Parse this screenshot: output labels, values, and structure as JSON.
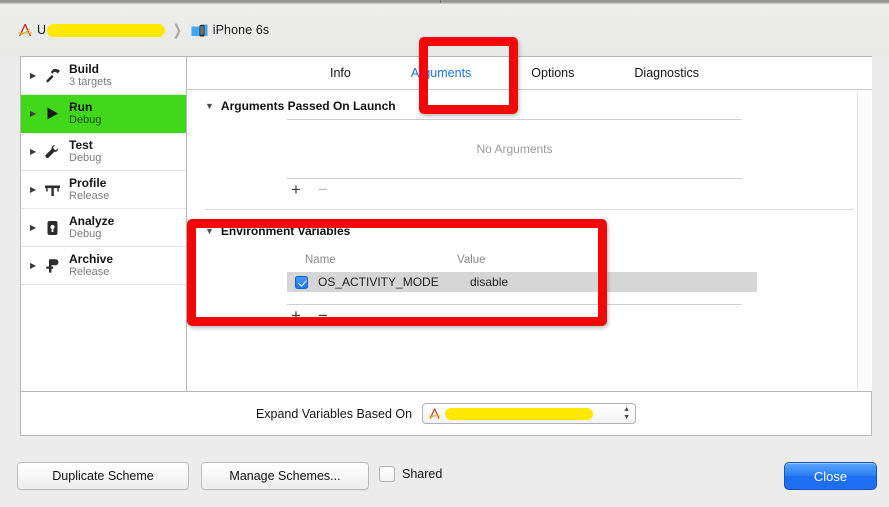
{
  "window": {
    "breadcrumb": {
      "scheme_icon": "xcode-scheme-icon",
      "scheme_prefix": "U",
      "scheme_redacted": true,
      "separator": "❯",
      "device_icon": "simulator-device-icon",
      "device_name": "iPhone 6s"
    }
  },
  "sidebar": {
    "items": [
      {
        "title": "Build",
        "subtitle": "3 targets",
        "icon": "hammer-icon",
        "selected": false
      },
      {
        "title": "Run",
        "subtitle": "Debug",
        "icon": "play-icon",
        "selected": true
      },
      {
        "title": "Test",
        "subtitle": "Debug",
        "icon": "wrench-icon",
        "selected": false
      },
      {
        "title": "Profile",
        "subtitle": "Release",
        "icon": "gauge-icon",
        "selected": false
      },
      {
        "title": "Analyze",
        "subtitle": "Debug",
        "icon": "analyze-icon",
        "selected": false
      },
      {
        "title": "Archive",
        "subtitle": "Release",
        "icon": "archive-icon",
        "selected": false
      }
    ]
  },
  "tabs": [
    {
      "label": "Info",
      "active": false
    },
    {
      "label": "Arguments",
      "active": true
    },
    {
      "label": "Options",
      "active": false
    },
    {
      "label": "Diagnostics",
      "active": false
    }
  ],
  "arguments_section": {
    "title": "Arguments Passed On Launch",
    "empty_text": "No Arguments",
    "add_label": "+",
    "remove_label": "−"
  },
  "environment_section": {
    "title": "Environment Variables",
    "columns": {
      "name": "Name",
      "value": "Value"
    },
    "rows": [
      {
        "enabled": true,
        "name": "OS_ACTIVITY_MODE",
        "value": "disable",
        "selected": true
      }
    ],
    "add_label": "+",
    "remove_label": "−"
  },
  "expand_variables": {
    "label": "Expand Variables Based On",
    "popup_icon": "xcode-scheme-icon",
    "popup_value_redacted": true,
    "stepper_up": "▲",
    "stepper_down": "▼"
  },
  "bottom_bar": {
    "duplicate_scheme": "Duplicate Scheme",
    "manage_schemes": "Manage Schemes...",
    "shared_label": "Shared",
    "shared_checked": false,
    "close": "Close"
  },
  "annotations": [
    {
      "name": "arguments-tab-highlight",
      "color": "#f30707"
    },
    {
      "name": "environment-variables-highlight",
      "color": "#f30707"
    }
  ],
  "colors": {
    "selection_green": "#41d81c",
    "active_tab_blue": "#1973e8",
    "annotation_red": "#f30707",
    "row_selected_gray": "#d6d6d6",
    "redaction_yellow": "#ffe800",
    "close_button_blue": "#1f6ef0"
  }
}
